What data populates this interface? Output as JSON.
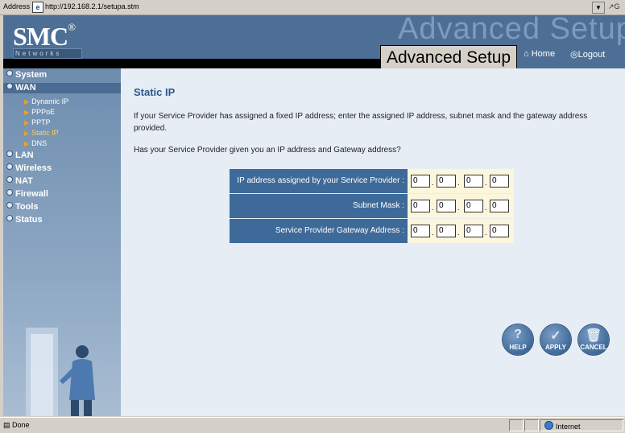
{
  "browser": {
    "address_label": "Address",
    "url": "http://192.168.2.1/setupa.stm",
    "status_text": "Done",
    "zone_text": "Internet"
  },
  "header": {
    "logo": "SMC",
    "logo_mark": "®",
    "subtitle": "Networks",
    "watermark": "Advanced Setup",
    "title": "Advanced Setup",
    "home_label": "Home",
    "logout_label": "Logout"
  },
  "sidebar": {
    "items": [
      {
        "label": "System"
      },
      {
        "label": "WAN"
      },
      {
        "label": "LAN"
      },
      {
        "label": "Wireless"
      },
      {
        "label": "NAT"
      },
      {
        "label": "Firewall"
      },
      {
        "label": "Tools"
      },
      {
        "label": "Status"
      }
    ],
    "wan_subitems": [
      {
        "label": "Dynamic IP"
      },
      {
        "label": "PPPoE"
      },
      {
        "label": "PPTP"
      },
      {
        "label": "Static IP"
      },
      {
        "label": "DNS"
      }
    ]
  },
  "main": {
    "title": "Static IP",
    "description": "If your Service Provider has assigned a fixed IP address; enter the assigned IP address, subnet mask and the gateway address provided.",
    "question": "Has your Service Provider given you an IP address and Gateway address?",
    "fields": [
      {
        "label": "IP address assigned by your Service Provider :",
        "octets": [
          "0",
          "0",
          "0",
          "0"
        ]
      },
      {
        "label": "Subnet Mask :",
        "octets": [
          "0",
          "0",
          "0",
          "0"
        ]
      },
      {
        "label": "Service Provider Gateway Address :",
        "octets": [
          "0",
          "0",
          "0",
          "0"
        ]
      }
    ]
  },
  "buttons": {
    "help": "HELP",
    "apply": "APPLY",
    "cancel": "CANCEL"
  },
  "colors": {
    "accent": "#3e6a99",
    "header": "#4d6f96",
    "content_bg": "#e6edf5",
    "active_link": "#ffd35a"
  }
}
